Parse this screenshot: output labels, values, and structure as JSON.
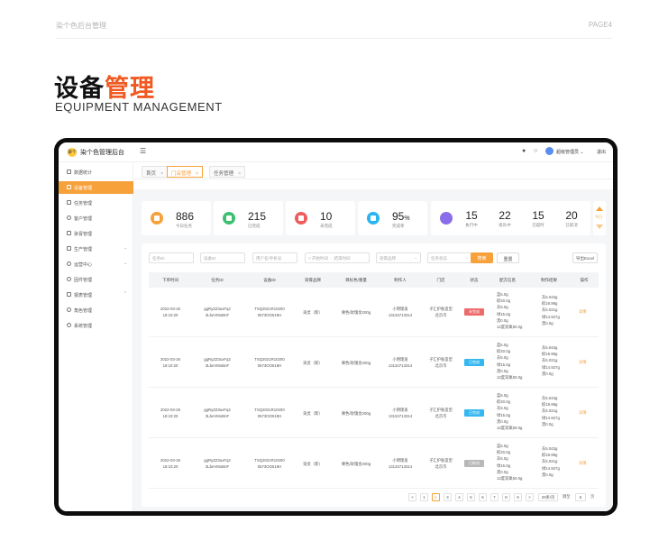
{
  "slide": {
    "header_left": "染个色后台管理",
    "header_right": "PAGE4",
    "title_plain": "设备",
    "title_accent": "管理",
    "subtitle": "EQUIPMENT MANAGEMENT",
    "accent_color": "#f05a22"
  },
  "app": {
    "logo_text": "染个",
    "name": "染个色管理后台",
    "user": "超级管理员",
    "logout": "退出"
  },
  "sidebar": {
    "items": [
      {
        "label": "数据统计",
        "icon": "home-icon"
      },
      {
        "label": "设备管理",
        "icon": "device-icon",
        "active": true
      },
      {
        "label": "任务管理",
        "icon": "task-icon"
      },
      {
        "label": "客户管理",
        "icon": "user-icon"
      },
      {
        "label": "染膏管理",
        "icon": "brush-icon"
      },
      {
        "label": "生产管理",
        "icon": "factory-icon",
        "expand": true
      },
      {
        "label": "运营中心",
        "icon": "globe-icon",
        "expand": true
      },
      {
        "label": "固件管理",
        "icon": "firmware-icon"
      },
      {
        "label": "报表管理",
        "icon": "report-icon",
        "expand": true
      },
      {
        "label": "角色管理",
        "icon": "role-icon"
      },
      {
        "label": "系统管理",
        "icon": "settings-icon"
      }
    ]
  },
  "tabs": [
    {
      "label": "首页"
    },
    {
      "label": "门店管理",
      "active": true
    },
    {
      "label": "任务管理"
    }
  ],
  "breadcrumb": "设备管理/任务列表",
  "stats": [
    {
      "value": "886",
      "label": "今日任务",
      "color": "#f7a13b"
    },
    {
      "value": "215",
      "label": "已完成",
      "color": "#3cc070"
    },
    {
      "value": "10",
      "label": "未完成",
      "color": "#ee5d5d"
    },
    {
      "value": "95",
      "unit": "%",
      "label": "完成率",
      "color": "#2bb5f0"
    }
  ],
  "stats_wide": [
    {
      "value": "15",
      "label": "执行中"
    },
    {
      "value": "22",
      "label": "排队中"
    },
    {
      "value": "15",
      "label": "已超时"
    },
    {
      "value": "20",
      "label": "已取消"
    }
  ],
  "stats_wide_icon_color": "#8a6de9",
  "side_arrow_label": "今日",
  "filters": {
    "task_id": "任务ID",
    "device_id": "设备ID",
    "customer": "用户名/手机号",
    "start_time": "开始时间",
    "end_time": "结束时间",
    "dye_brand": "染膏品牌",
    "task_status": "任务状态",
    "search": "搜索",
    "reset": "重置",
    "export": "导出Excel"
  },
  "table": {
    "headers": [
      "下单时间",
      "任务ID",
      "设备ID",
      "染膏品牌",
      "目标色/重量",
      "制作人",
      "门店",
      "状态",
      "配方信息",
      "制作结果",
      "操作"
    ],
    "rows": [
      {
        "time": [
          "2022-03-26",
          "18:10:20"
        ],
        "task_id": [
          "ggRyZZ3uxFq2",
          "3LbeVMoBnF"
        ],
        "device_id": [
          "TSQ2021R10200",
          "0573OO519H"
        ],
        "brand": "染灵（新）",
        "target": "栗色/玫瑰金200g",
        "maker": [
          "小明理发",
          "13134713314"
        ],
        "store": [
          "子汇护肤造型",
          "北京市"
        ],
        "status": "未完成",
        "status_color": "#ee6a6a",
        "recipe": [
          "蓝5.0g",
          "棕20.0g",
          "灰5.0g",
          "绿15.0g",
          "黑0.0g",
          "12度双氧50.0g"
        ],
        "result": [
          "灰5.043g",
          "棕19.99g",
          "灰5.021g",
          "绿14.927g",
          "黑0.0g"
        ],
        "op": "详情"
      },
      {
        "time": [
          "2022-03-26",
          "18:10:20"
        ],
        "task_id": [
          "ggRyZZ3uxFq2",
          "3LbeVMoBnF"
        ],
        "device_id": [
          "TSQ2021R10200",
          "0573OO519H"
        ],
        "brand": "染灵（新）",
        "target": "栗色/玫瑰金200g",
        "maker": [
          "小明理发",
          "13134713314"
        ],
        "store": [
          "子汇护肤造型",
          "北京市"
        ],
        "status": "已完成",
        "status_color": "#35b8f0",
        "recipe": [
          "蓝5.0g",
          "棕20.0g",
          "灰5.0g",
          "绿15.0g",
          "黑0.0g",
          "12度双氧50.0g"
        ],
        "result": [
          "灰5.043g",
          "棕19.99g",
          "灰5.021g",
          "绿14.927g",
          "黑0.0g"
        ],
        "op": "详情"
      },
      {
        "time": [
          "2022-03-26",
          "18:10:20"
        ],
        "task_id": [
          "ggRyZZ3uxFq2",
          "3LbeVMoBnF"
        ],
        "device_id": [
          "TSQ2021R10200",
          "0573OO519H"
        ],
        "brand": "染灵（新）",
        "target": "栗色/玫瑰金200g",
        "maker": [
          "小明理发",
          "13134713314"
        ],
        "store": [
          "子汇护肤造型",
          "北京市"
        ],
        "status": "已完成",
        "status_color": "#35b8f0",
        "recipe": [
          "蓝5.0g",
          "棕20.0g",
          "灰5.0g",
          "绿15.0g",
          "黑0.0g",
          "12度双氧50.0g"
        ],
        "result": [
          "灰5.043g",
          "棕19.99g",
          "灰5.021g",
          "绿14.927g",
          "黑0.0g"
        ],
        "op": "详情"
      },
      {
        "time": [
          "2022-03-26",
          "18:10:20"
        ],
        "task_id": [
          "ggRyZZ3uxFq2",
          "3LbeVMoBnF"
        ],
        "device_id": [
          "TSQ2021R10200",
          "0573OO519H"
        ],
        "brand": "染灵（新）",
        "target": "栗色/玫瑰金200g",
        "maker": [
          "小明理发",
          "13134713314"
        ],
        "store": [
          "子汇护肤造型",
          "北京市"
        ],
        "status": "已取消",
        "status_color": "#b8b8b8",
        "recipe": [
          "蓝5.0g",
          "棕20.0g",
          "灰5.0g",
          "绿15.0g",
          "黑0.0g",
          "12度双氧50.0g"
        ],
        "result": [
          "灰5.043g",
          "棕19.99g",
          "灰5.021g",
          "绿14.927g",
          "黑0.0g"
        ],
        "op": "详情"
      }
    ]
  },
  "pager": {
    "prev": "<",
    "pages": [
      "1",
      "2",
      "3",
      "4",
      "5",
      "6",
      "7",
      "8",
      "9"
    ],
    "current": "2",
    "next": ">",
    "per_page": "20条/页",
    "jump_label": "跳至",
    "jump_value": "5",
    "page_unit": "页"
  }
}
